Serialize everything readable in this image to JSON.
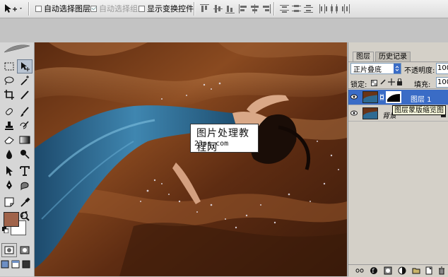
{
  "options_bar": {
    "auto_select_layer": "自动选择图层",
    "auto_select_group": "自动选择组",
    "show_transform_controls": "显示变换控件"
  },
  "layers_panel": {
    "tab_layers": "图层",
    "tab_history": "历史记录",
    "blend_mode": "正片叠底",
    "opacity_label": "不透明度:",
    "opacity_value": "100",
    "lock_label": "锁定:",
    "fill_label": "填充:",
    "fill_value": "100",
    "layers": [
      {
        "name": "图层 1",
        "selected": true
      },
      {
        "name": "背景",
        "selected": false
      }
    ],
    "tooltip": "图层蒙版缩览图"
  },
  "watermark": {
    "title": "图片处理教程网",
    "url": "23ps.com"
  },
  "colors": {
    "foreground": "#a0634a",
    "background": "#ffffff",
    "selection": "#3a6cc6",
    "silk": "#6a3417",
    "dress": "#2e6a92"
  }
}
